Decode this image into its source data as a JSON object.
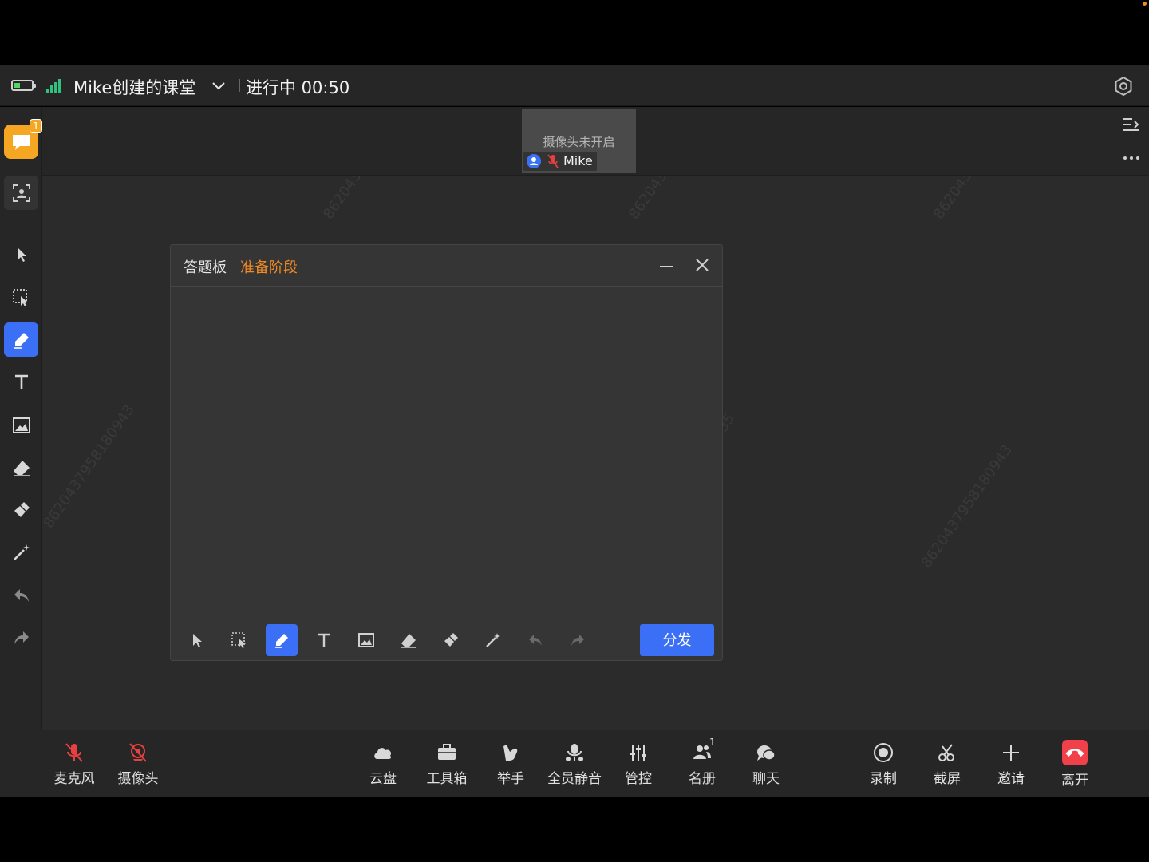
{
  "header": {
    "room_title": "Mike创建的课堂",
    "status": "进行中 00:50"
  },
  "video": {
    "camera_off_text": "摄像头未开启",
    "participant_name": "Mike"
  },
  "left_rail": {
    "chat_badge": "1"
  },
  "panel": {
    "title": "答题板",
    "stage": "准备阶段",
    "distribute_label": "分发"
  },
  "bottom_bar": {
    "left": [
      {
        "label": "麦克风",
        "icon": "mic-off-icon"
      },
      {
        "label": "摄像头",
        "icon": "camera-off-icon"
      }
    ],
    "center": [
      {
        "label": "云盘",
        "icon": "cloud-icon"
      },
      {
        "label": "工具箱",
        "icon": "toolbox-icon"
      },
      {
        "label": "举手",
        "icon": "raise-hand-icon"
      },
      {
        "label": "全员静音",
        "icon": "mute-all-icon"
      },
      {
        "label": "管控",
        "icon": "controls-icon"
      },
      {
        "label": "名册",
        "icon": "roster-icon"
      },
      {
        "label": "聊天",
        "icon": "chat-icon"
      }
    ],
    "right": [
      {
        "label": "录制",
        "icon": "record-icon"
      },
      {
        "label": "截屏",
        "icon": "screenshot-icon"
      },
      {
        "label": "邀请",
        "icon": "invite-icon"
      },
      {
        "label": "离开",
        "icon": "leave-icon"
      }
    ],
    "roster_count": "1"
  },
  "colors": {
    "accent": "#3b6ff5",
    "stage_orange": "#f08a24",
    "leave_red": "#f0404a",
    "signal_green": "#2ec27e"
  }
}
